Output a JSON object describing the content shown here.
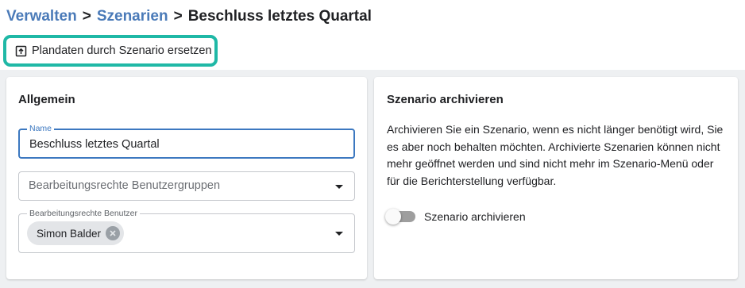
{
  "breadcrumb": {
    "items": [
      "Verwalten",
      "Szenarien"
    ],
    "current": "Beschluss letztes Quartal",
    "separator": ">"
  },
  "toolbar": {
    "replace_button": {
      "label": "Plandaten durch Szenario ersetzen",
      "icon": "upload-box-icon"
    }
  },
  "general": {
    "title": "Allgemein",
    "name_field": {
      "label": "Name",
      "value": "Beschluss letztes Quartal"
    },
    "groups_field": {
      "placeholder": "Bearbeitungsrechte Benutzergruppen"
    },
    "users_field": {
      "label": "Bearbeitungsrechte Benutzer",
      "chips": [
        {
          "label": "Simon Balder"
        }
      ]
    }
  },
  "archive": {
    "title": "Szenario archivieren",
    "description": "Archivieren Sie ein Szenario, wenn es nicht länger benötigt wird, Sie es aber noch behalten möchten. Archivierte Szenarien können nicht mehr geöffnet werden und sind nicht mehr im Szenario-Menü oder für die Berichterstellung verfügbar.",
    "toggle_label": "Szenario archivieren",
    "toggle_on": false
  },
  "colors": {
    "link": "#4a7ab8",
    "highlight": "#1fb8a6",
    "focus": "#3c78c0"
  }
}
